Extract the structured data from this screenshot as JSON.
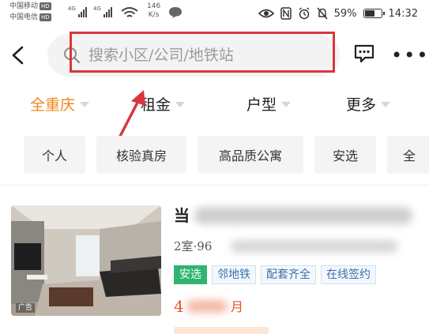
{
  "status_bar": {
    "carrier1": "中国移动",
    "carrier2": "中国电信",
    "hd_badge": "HD",
    "network1": "4G",
    "network2": "4G",
    "speed_value": "146",
    "speed_unit": "K/s",
    "battery_percent": "59%",
    "time": "14:32"
  },
  "search": {
    "placeholder": "搜索小区/公司/地铁站"
  },
  "filters": [
    {
      "label": "全重庆",
      "active": true
    },
    {
      "label": "租金",
      "active": false
    },
    {
      "label": "户型",
      "active": false
    },
    {
      "label": "更多",
      "active": false
    }
  ],
  "chips": [
    "个人",
    "核验真房",
    "高品质公寓",
    "安选",
    "全"
  ],
  "listing": {
    "title_fragment": "当",
    "meta_fragment": "2室·96",
    "tags": [
      "安选",
      "邻地铁",
      "配套齐全",
      "在线签约"
    ],
    "price_fragment": "4",
    "price_unit": "月",
    "ad_label": "广告"
  },
  "colors": {
    "accent_orange": "#f08519",
    "annotation_red": "#d9363e",
    "price_red": "#e8542a",
    "tag_green": "#2fb56f",
    "tag_blue": "#3d6ea8"
  }
}
